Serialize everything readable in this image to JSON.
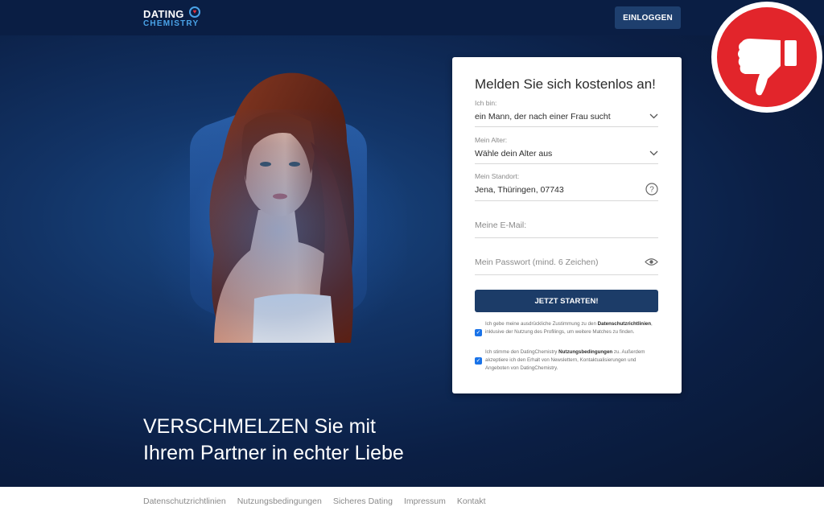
{
  "header": {
    "logo_line1": "DATING",
    "logo_line2": "CHEMISTRY",
    "login_label": "EINLOGGEN"
  },
  "form": {
    "title": "Melden Sie sich kostenlos an!",
    "iam_label": "Ich bin:",
    "iam_value": "ein Mann, der nach einer Frau sucht",
    "age_label": "Mein Alter:",
    "age_value": "Wähle dein Alter aus",
    "location_label": "Mein Standort:",
    "location_value": "Jena, Thüringen, 07743",
    "email_placeholder": "Meine E-Mail:",
    "password_placeholder": "Mein Passwort (mind. 6 Zeichen)",
    "submit_label": "JETZT STARTEN!",
    "consent1_pre": "Ich gebe meine ausdrückliche Zustimmung zu den",
    "consent1_link": "Datenschutzrichtlinien",
    "consent1_post": ", inklusive der Nutzung des Profilings, um weitere Matches zu finden.",
    "consent2_pre": "Ich stimme den DatingChemistry",
    "consent2_link": "Nutzungsbedingungen",
    "consent2_post": "zu. Außerdem akzeptiere ich den Erhalt von Newslettern, Kontaktualisierungen und Angeboten von DatingChemistry."
  },
  "headline": {
    "line1": "VERSCHMELZEN Sie mit",
    "line2": "Ihrem Partner in echter Liebe"
  },
  "footer": {
    "links": [
      "Datenschutzrichtlinien",
      "Nutzungsbedingungen",
      "Sicheres Dating",
      "Impressum",
      "Kontakt"
    ]
  },
  "colors": {
    "accent": "#1c3c68",
    "thumb_red": "#e2252b"
  },
  "icons": {
    "chevron": "chevron-down-icon",
    "help": "question-circle-icon",
    "eye": "eye-icon",
    "thumb": "thumbs-down-icon"
  }
}
